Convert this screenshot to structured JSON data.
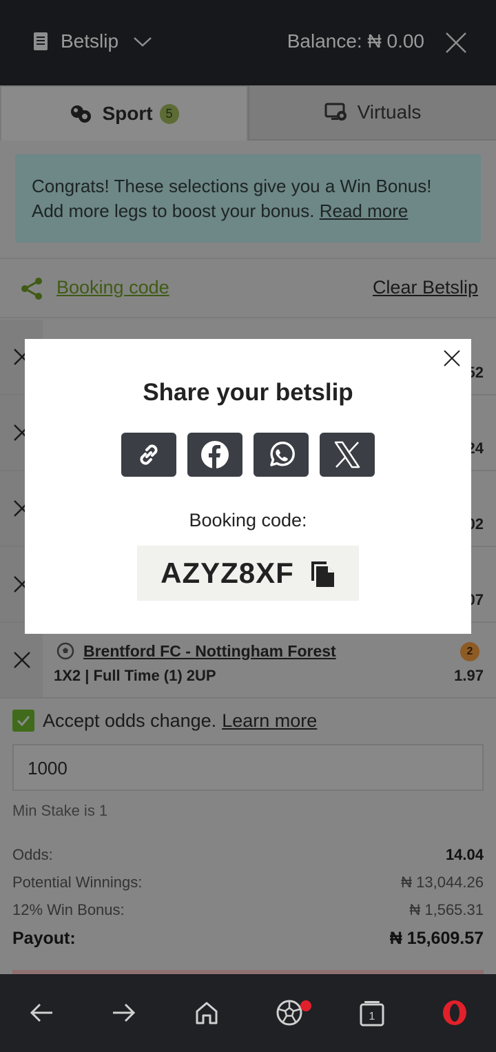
{
  "header": {
    "title": "Betslip",
    "balance": "Balance: ₦ 0.00"
  },
  "tabs": [
    {
      "label": "Sport",
      "badge": "5"
    },
    {
      "label": "Virtuals"
    }
  ],
  "banner": {
    "text": "Congrats! These selections give you a Win Bonus! Add more legs to boost your bonus. ",
    "link": "Read more"
  },
  "actions": {
    "booking_code": "Booking code",
    "clear": "Clear Betslip"
  },
  "selections": [
    {
      "odds_fragment": "52"
    },
    {
      "odds_fragment": "24"
    },
    {
      "odds_fragment": "02"
    },
    {
      "odds_fragment": "07"
    },
    {
      "match": "Brentford FC - Nottingham Forest",
      "market": "1X2 | Full Time (1) 2UP",
      "odds": "1.97",
      "boost": "2"
    }
  ],
  "accept": {
    "text": "Accept odds change.",
    "link": "Learn more"
  },
  "stake": {
    "value": "1000",
    "min_note": "Min Stake is 1"
  },
  "summary": {
    "odds_label": "Odds:",
    "odds_value": "14.04",
    "winnings_label": "Potential Winnings:",
    "winnings_value": "₦ 13,044.26",
    "bonus_label": "12% Win Bonus:",
    "bonus_value": "₦ 1,565.31",
    "payout_label": "Payout:",
    "payout_value": "₦ 15,609.57"
  },
  "modal": {
    "title": "Share your betslip",
    "share_buttons": [
      "link-icon",
      "facebook-icon",
      "whatsapp-icon",
      "x-icon"
    ],
    "booking_label": "Booking code:",
    "code": "AZYZ8XF"
  },
  "navbar": {
    "tab_count": "1"
  },
  "colors": {
    "accent_green": "#5a9a1c",
    "modal_button": "#3b3e44",
    "opera_red": "#e0212b"
  }
}
